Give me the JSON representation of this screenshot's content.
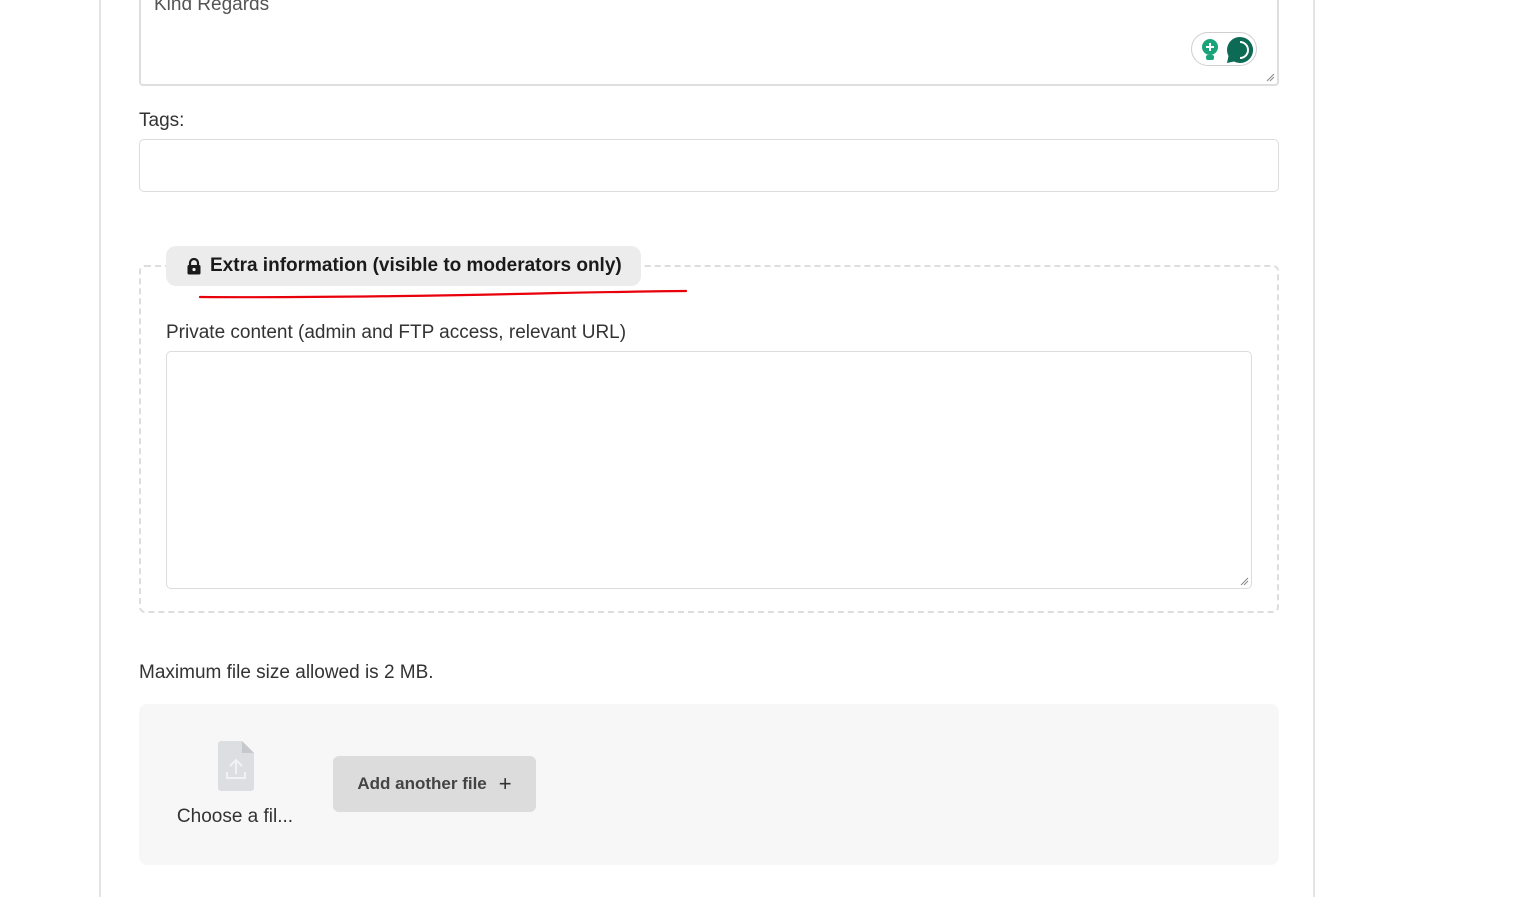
{
  "message": {
    "visible_text": "Kind Regards"
  },
  "tags": {
    "label": "Tags:",
    "value": ""
  },
  "extra_info": {
    "legend_text": "Extra information (visible to moderators only)",
    "legend_icon": "lock-icon",
    "private_content_label": "Private content (admin and FTP access, relevant URL)",
    "private_content_value": ""
  },
  "attachments": {
    "max_size_text": "Maximum file size allowed is 2 MB.",
    "choose_file_label": "Choose a fil...",
    "add_file_label": "Add another file",
    "add_file_icon": "+"
  },
  "colors": {
    "annotation_red": "#e8000b",
    "assistant_green": "#1aa37a",
    "assistant_dark_green": "#0d6b55"
  }
}
